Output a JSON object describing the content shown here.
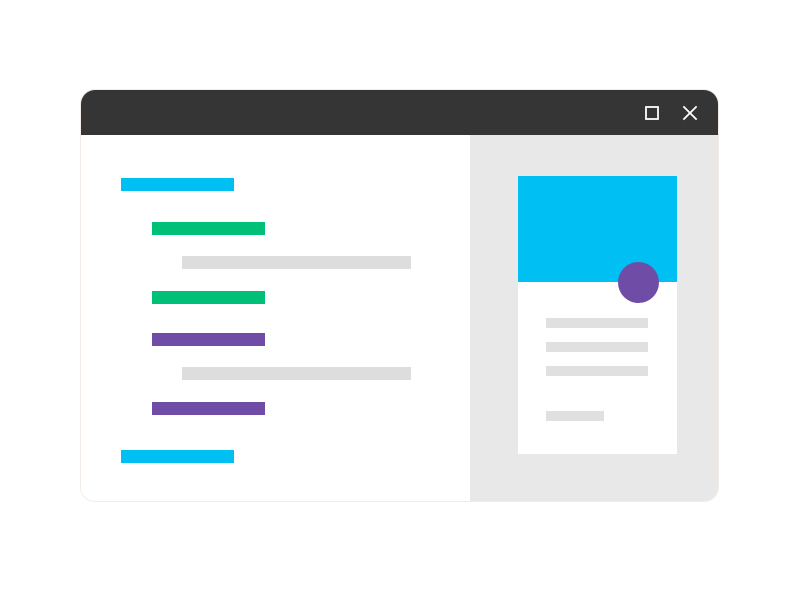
{
  "window": {
    "titlebar_color": "#353535",
    "controls": [
      {
        "name": "maximize",
        "icon": "maximize-icon"
      },
      {
        "name": "close",
        "icon": "close-icon"
      }
    ]
  },
  "colors": {
    "tag_blue": "#00bff3",
    "tag_green": "#00c078",
    "tag_purple": "#6f4da6",
    "placeholder_gray": "#dddddd",
    "preview_background": "#e8e8e8",
    "card_header": "#00bff3",
    "avatar": "#6f4da6"
  },
  "code_pane": {
    "lines": [
      {
        "kind": "tag",
        "color": "blue",
        "indent": 0
      },
      {
        "kind": "tag",
        "color": "green",
        "indent": 1
      },
      {
        "kind": "content",
        "color": "gray",
        "indent": 2
      },
      {
        "kind": "tag",
        "color": "green",
        "indent": 1
      },
      {
        "kind": "tag",
        "color": "purple",
        "indent": 1
      },
      {
        "kind": "content",
        "color": "gray",
        "indent": 2
      },
      {
        "kind": "tag",
        "color": "purple",
        "indent": 1
      },
      {
        "kind": "tag",
        "color": "blue",
        "indent": 0
      }
    ]
  },
  "preview_pane": {
    "card": {
      "header_color": "#00bff3",
      "avatar_color": "#6f4da6",
      "text_lines": 4
    }
  }
}
